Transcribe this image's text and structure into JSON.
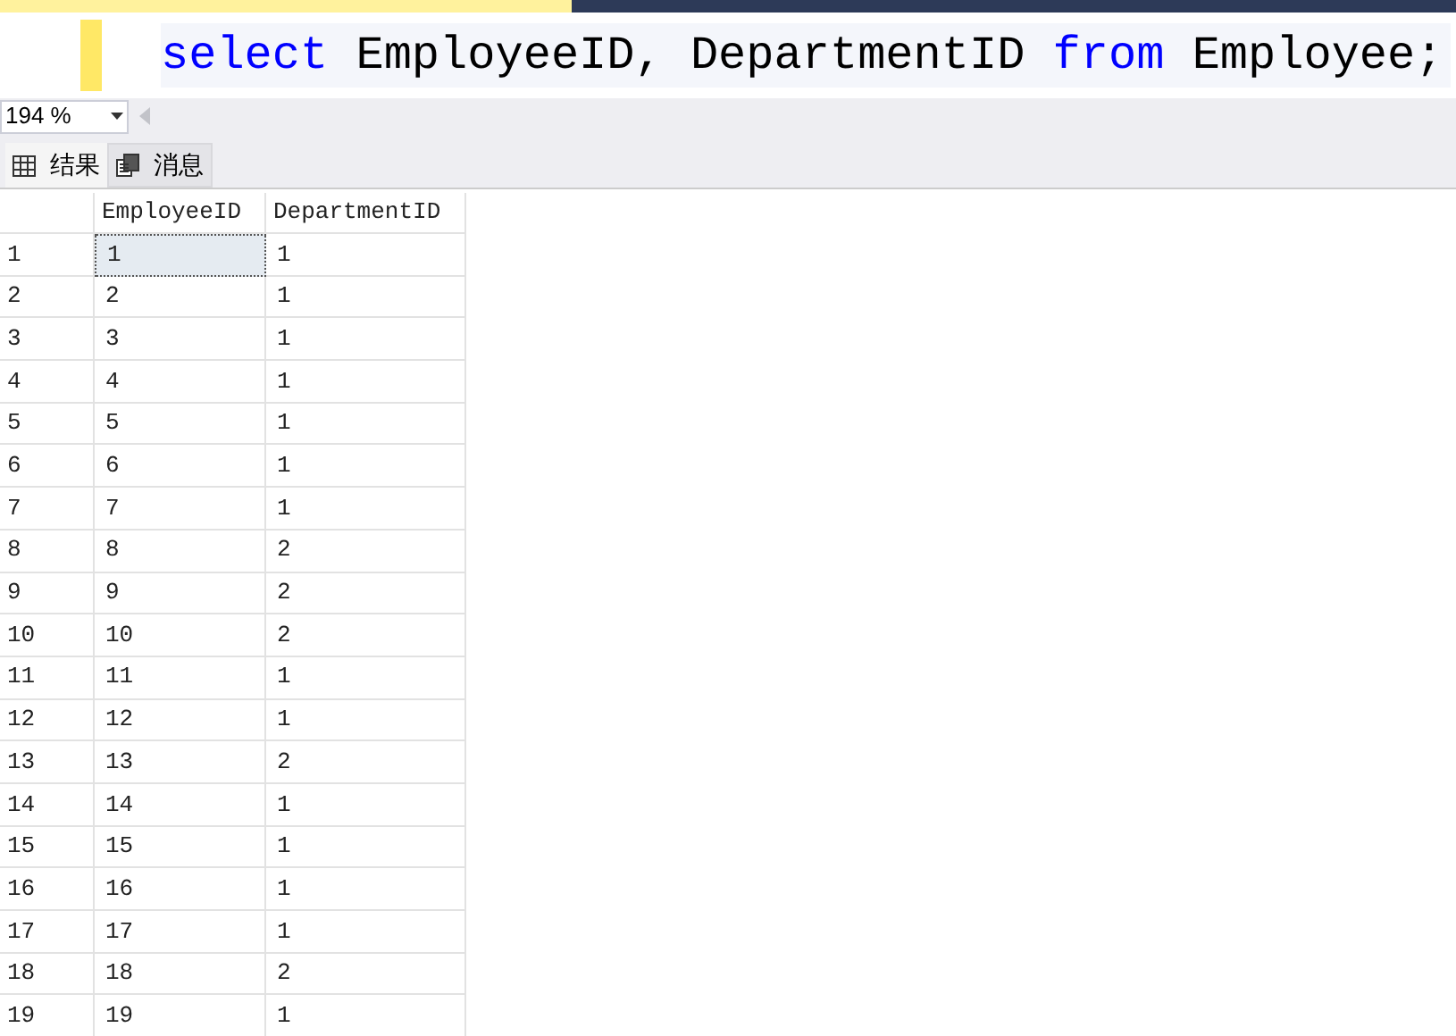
{
  "editor": {
    "code": [
      {
        "kind": "keyword",
        "text": "select"
      },
      {
        "kind": "plain",
        "text": " EmployeeID, DepartmentID "
      },
      {
        "kind": "keyword",
        "text": "from"
      },
      {
        "kind": "plain",
        "text": " Employee;"
      }
    ]
  },
  "zoom": {
    "value": "194 %"
  },
  "tabs": [
    {
      "label": "结果",
      "kind": "grid",
      "selected": true
    },
    {
      "label": "消息",
      "kind": "messages",
      "selected": false
    }
  ],
  "table": {
    "columns": [
      "EmployeeID",
      "DepartmentID"
    ],
    "rows": [
      {
        "number": "1",
        "cells": [
          {
            "text": "1",
            "selected": true
          },
          {
            "text": "1",
            "selected": false
          }
        ]
      },
      {
        "number": "2",
        "cells": [
          {
            "text": "2",
            "selected": false
          },
          {
            "text": "1",
            "selected": false
          }
        ]
      },
      {
        "number": "3",
        "cells": [
          {
            "text": "3",
            "selected": false
          },
          {
            "text": "1",
            "selected": false
          }
        ]
      },
      {
        "number": "4",
        "cells": [
          {
            "text": "4",
            "selected": false
          },
          {
            "text": "1",
            "selected": false
          }
        ]
      },
      {
        "number": "5",
        "cells": [
          {
            "text": "5",
            "selected": false
          },
          {
            "text": "1",
            "selected": false
          }
        ]
      },
      {
        "number": "6",
        "cells": [
          {
            "text": "6",
            "selected": false
          },
          {
            "text": "1",
            "selected": false
          }
        ]
      },
      {
        "number": "7",
        "cells": [
          {
            "text": "7",
            "selected": false
          },
          {
            "text": "1",
            "selected": false
          }
        ]
      },
      {
        "number": "8",
        "cells": [
          {
            "text": "8",
            "selected": false
          },
          {
            "text": "2",
            "selected": false
          }
        ]
      },
      {
        "number": "9",
        "cells": [
          {
            "text": "9",
            "selected": false
          },
          {
            "text": "2",
            "selected": false
          }
        ]
      },
      {
        "number": "10",
        "cells": [
          {
            "text": "10",
            "selected": false
          },
          {
            "text": "2",
            "selected": false
          }
        ]
      },
      {
        "number": "11",
        "cells": [
          {
            "text": "11",
            "selected": false
          },
          {
            "text": "1",
            "selected": false
          }
        ]
      },
      {
        "number": "12",
        "cells": [
          {
            "text": "12",
            "selected": false
          },
          {
            "text": "1",
            "selected": false
          }
        ]
      },
      {
        "number": "13",
        "cells": [
          {
            "text": "13",
            "selected": false
          },
          {
            "text": "2",
            "selected": false
          }
        ]
      },
      {
        "number": "14",
        "cells": [
          {
            "text": "14",
            "selected": false
          },
          {
            "text": "1",
            "selected": false
          }
        ]
      },
      {
        "number": "15",
        "cells": [
          {
            "text": "15",
            "selected": false
          },
          {
            "text": "1",
            "selected": false
          }
        ]
      },
      {
        "number": "16",
        "cells": [
          {
            "text": "16",
            "selected": false
          },
          {
            "text": "1",
            "selected": false
          }
        ]
      },
      {
        "number": "17",
        "cells": [
          {
            "text": "17",
            "selected": false
          },
          {
            "text": "1",
            "selected": false
          }
        ]
      },
      {
        "number": "18",
        "cells": [
          {
            "text": "18",
            "selected": false
          },
          {
            "text": "2",
            "selected": false
          }
        ]
      },
      {
        "number": "19",
        "cells": [
          {
            "text": "19",
            "selected": false
          },
          {
            "text": "1",
            "selected": false
          }
        ]
      }
    ]
  }
}
